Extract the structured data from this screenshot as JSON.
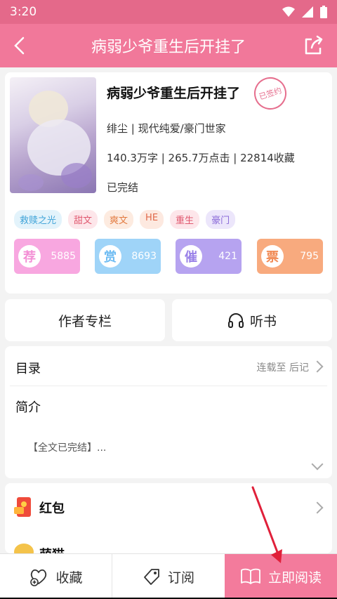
{
  "status_bar": {
    "time": "3:20"
  },
  "header": {
    "title": "病弱少爷重生后开挂了"
  },
  "book": {
    "title": "病弱少爷重生后开挂了",
    "stamp": "已签约",
    "author_line": "绯尘 | 现代纯爱/豪门世家",
    "stats_line": "140.3万字 | 265.7万点击 | 22814收藏",
    "status": "已完结"
  },
  "tags": [
    "救赎之光",
    "甜文",
    "爽文",
    "HE",
    "重生",
    "豪门"
  ],
  "actions": [
    {
      "badge": "荐",
      "value": "5885",
      "color": "#f8a7e0"
    },
    {
      "badge": "赏",
      "value": "8693",
      "color": "#9fd4f8"
    },
    {
      "badge": "催",
      "value": "421",
      "color": "#b6a3f0"
    },
    {
      "badge": "票",
      "value": "795",
      "color": "#f8aa7e"
    }
  ],
  "buttons": {
    "author_column": "作者专栏",
    "listen": "听书"
  },
  "toc": {
    "label": "目录",
    "status": "连载至 后记"
  },
  "intro": {
    "label": "简介",
    "text": "【全文已完结】..."
  },
  "extras": {
    "red_packet": "红包",
    "second": "萌猫"
  },
  "bottom": {
    "favorite": "收藏",
    "subscribe": "订阅",
    "read_now": "立即阅读"
  }
}
